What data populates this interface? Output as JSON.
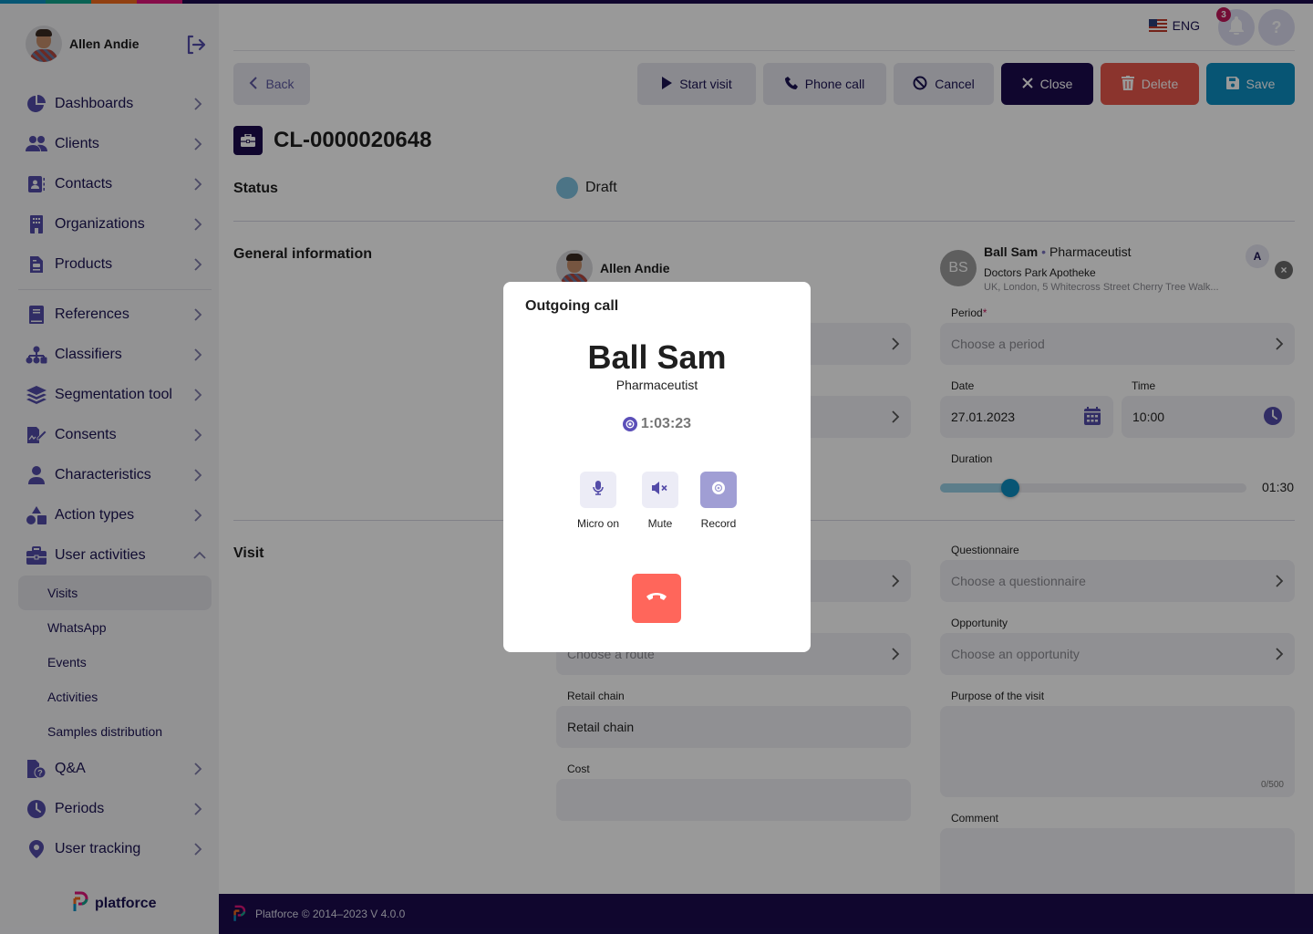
{
  "brand": {
    "stripe_colors": [
      "#0b8fc1",
      "#0fa38d",
      "#f26b1d",
      "#e0157a",
      "#1b0b4e"
    ],
    "primary": "#1b0b4e",
    "accent": "#534ba8",
    "danger": "#e8574c",
    "info": "#0d8ec2",
    "logo_text": "platforce"
  },
  "sidebar": {
    "user_name": "Allen Andie",
    "logout_icon": "logout-icon",
    "items": [
      {
        "label": "Dashboards",
        "icon": "pie-chart-icon"
      },
      {
        "label": "Clients",
        "icon": "users-icon"
      },
      {
        "label": "Contacts",
        "icon": "address-book-icon"
      },
      {
        "label": "Organizations",
        "icon": "building-icon"
      },
      {
        "label": "Products",
        "icon": "document-icon"
      },
      {
        "label": "References",
        "icon": "book-icon"
      },
      {
        "label": "Classifiers",
        "icon": "sitemap-icon"
      },
      {
        "label": "Segmentation tool",
        "icon": "layers-icon"
      },
      {
        "label": "Consents",
        "icon": "signature-icon"
      },
      {
        "label": "Characteristics",
        "icon": "user-icon"
      },
      {
        "label": "Action types",
        "icon": "shapes-icon"
      },
      {
        "label": "User activities",
        "icon": "briefcase-icon",
        "expanded": true
      },
      {
        "label": "Q&A",
        "icon": "file-question-icon"
      },
      {
        "label": "Periods",
        "icon": "clock-icon"
      },
      {
        "label": "User tracking",
        "icon": "location-pin-icon"
      }
    ],
    "sub_items": [
      {
        "label": "Visits",
        "active": true
      },
      {
        "label": "WhatsApp"
      },
      {
        "label": "Events"
      },
      {
        "label": "Activities"
      },
      {
        "label": "Samples distribution"
      }
    ]
  },
  "topbar": {
    "language": "ENG",
    "notification_count": "3",
    "help_label": "?"
  },
  "toolbar": {
    "back": "Back",
    "start_visit": "Start visit",
    "phone_call": "Phone call",
    "cancel": "Cancel",
    "close": "Close",
    "delete": "Delete",
    "save": "Save"
  },
  "record": {
    "id": "CL-0000020648",
    "status_label": "Status",
    "status_value": "Draft",
    "status_color": "#7fc2e0",
    "general_label": "General information",
    "visit_label": "Visit",
    "owner_name": "Allen Andie"
  },
  "client": {
    "initials": "BS",
    "name": "Ball Sam",
    "role": "Pharmaceutist",
    "organization": "Doctors Park Apotheke",
    "address": "UK, London, 5 Whitecross Street Cherry Tree Walk...",
    "tag": "A"
  },
  "form": {
    "period_label": "Period",
    "period_required": "*",
    "period_placeholder": "Choose a period",
    "date_label": "Date",
    "date_value": "27.01.2023",
    "time_label": "Time",
    "time_value": "10:00",
    "duration_label": "Duration",
    "duration_value": "01:30",
    "duration_fraction": 0.23,
    "questionnaire_label": "Questionnaire",
    "questionnaire_placeholder": "Choose a questionnaire",
    "opportunity_label": "Opportunity",
    "opportunity_placeholder": "Choose an opportunity",
    "purpose_label": "Purpose of the visit",
    "purpose_counter": "0/500",
    "comment_label": "Comment",
    "route_placeholder": "Choose a route",
    "retail_chain_label": "Retail chain",
    "retail_chain_value": "Retail chain",
    "cost_label": "Cost",
    "cost_value": ""
  },
  "call_modal": {
    "title": "Outgoing call",
    "name": "Ball Sam",
    "role": "Pharmaceutist",
    "timer": "1:03:23",
    "controls": [
      {
        "label": "Micro on",
        "icon": "microphone-icon",
        "active": false
      },
      {
        "label": "Mute",
        "icon": "speaker-mute-icon",
        "active": false
      },
      {
        "label": "Record",
        "icon": "record-icon",
        "active": true
      }
    ],
    "hangup_icon": "hang-up-icon"
  },
  "footer": {
    "text": "Platforce © 2014–2023 V 4.0.0"
  }
}
